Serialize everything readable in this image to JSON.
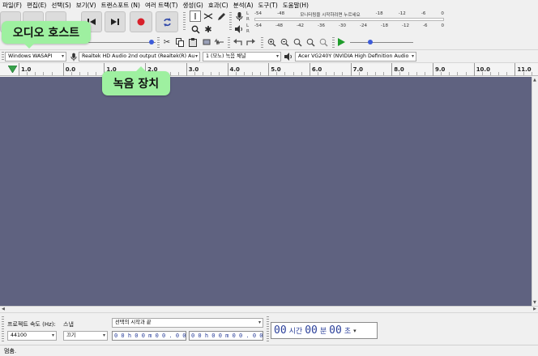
{
  "menu": [
    "파일(F)",
    "편집(E)",
    "선택(S)",
    "보기(V)",
    "트랜스포트 (N)",
    "여러 트랙(T)",
    "생성(G)",
    "효과(C)",
    "분석(A)",
    "도구(T)",
    "도움말(H)"
  ],
  "meters": {
    "record_ticks": [
      "-54",
      "-48",
      "모니터링을 시작하려면 누르세요",
      "-18",
      "-12",
      "-6",
      "0"
    ],
    "play_ticks": [
      "-54",
      "-48",
      "-42",
      "-36",
      "-30",
      "-24",
      "-18",
      "-12",
      "-6",
      "0"
    ],
    "channel_l": "L",
    "channel_r": "R"
  },
  "devices": {
    "host": "Windows WASAPI",
    "recording": "Realtek HD Audio 2nd output (Realtek(R) Au",
    "channels": "1 (모노) 녹음 채널",
    "playback": "Acer VG240Y (NVIDIA High Definition Audio"
  },
  "ruler_labels": [
    "1.0",
    "0.0",
    "1.0",
    "2.0",
    "3.0",
    "4.0",
    "5.0",
    "6.0",
    "7.0",
    "8.0",
    "9.0",
    "10.0",
    "11.0"
  ],
  "selection": {
    "rate_label": "프로젝트 속도 (Hz):",
    "rate_value": "44100",
    "snap_label": "스냅",
    "snap_value": "끄기",
    "sel_label": "선택의 시작과 끝",
    "start_time": "0 0 h 0 0 m 0 0 . 0 0 0 s",
    "end_time": "0 0 h 0 0 m 0 0 . 0 0 0 s"
  },
  "big_time": {
    "h": "00",
    "h_unit": "시간",
    "m": "00",
    "m_unit": "분",
    "s": "00",
    "s_unit": "초"
  },
  "status": "멈춤.",
  "callouts": {
    "host": "오디오 호스트",
    "recording": "녹음 장치"
  },
  "colors": {
    "track_bg": "#5f6280",
    "callout": "#9ef0a0",
    "record_red": "#d8202a",
    "play_green": "#1f9c2b"
  }
}
